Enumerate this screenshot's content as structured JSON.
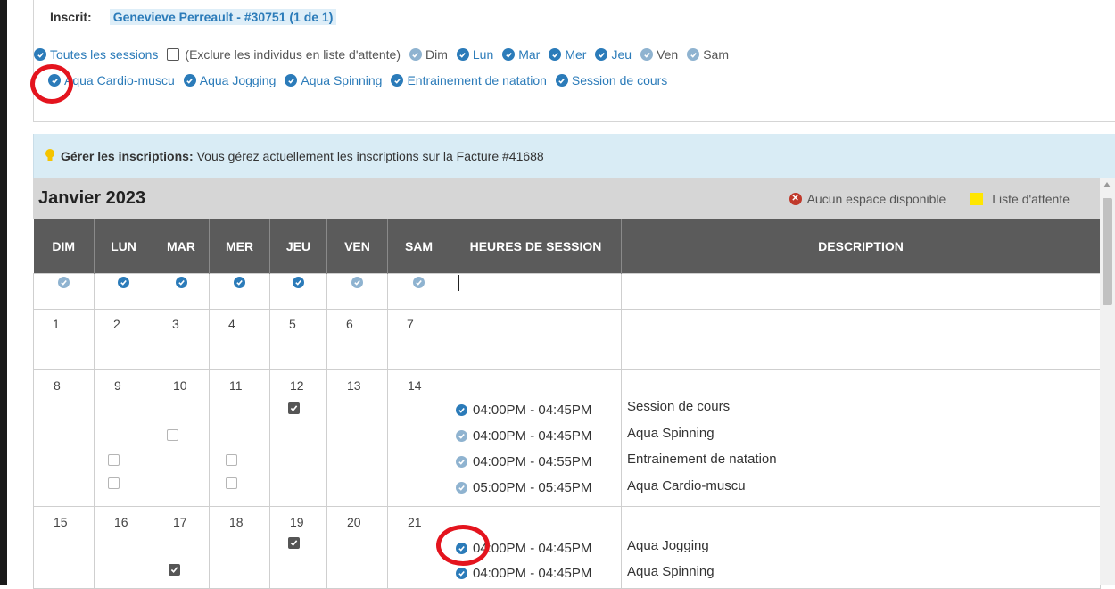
{
  "enrolled": {
    "label": "Inscrit:",
    "name": "Genevieve Perreault - #30751 (1 de 1)"
  },
  "filters": {
    "all_sessions": "Toutes les sessions",
    "exclude_waitlist": "(Exclure les individus en liste d'attente)",
    "days": [
      {
        "label": "Dim",
        "checked": false
      },
      {
        "label": "Lun",
        "checked": true
      },
      {
        "label": "Mar",
        "checked": true
      },
      {
        "label": "Mer",
        "checked": true
      },
      {
        "label": "Jeu",
        "checked": true
      },
      {
        "label": "Ven",
        "checked": false
      },
      {
        "label": "Sam",
        "checked": false
      }
    ],
    "programs": [
      {
        "label": "Aqua Cardio-muscu"
      },
      {
        "label": "Aqua Jogging"
      },
      {
        "label": "Aqua Spinning"
      },
      {
        "label": "Entrainement de natation"
      },
      {
        "label": "Session de cours"
      }
    ]
  },
  "alert": {
    "title": "Gérer les inscriptions:",
    "text": "Vous gérez actuellement les inscriptions sur la Facture #41688"
  },
  "calendar": {
    "month": "Janvier 2023",
    "legend_full": "Aucun espace disponible",
    "legend_waitlist": "Liste d'attente",
    "headers": [
      "DIM",
      "LUN",
      "MAR",
      "MER",
      "JEU",
      "VEN",
      "SAM",
      "HEURES DE SESSION",
      "DESCRIPTION"
    ],
    "week1": [
      "1",
      "2",
      "3",
      "4",
      "5",
      "6",
      "7"
    ],
    "week2": [
      "8",
      "9",
      "10",
      "11",
      "12",
      "13",
      "14"
    ],
    "week3": [
      "15",
      "16",
      "17",
      "18",
      "19",
      "20",
      "21"
    ],
    "week2_sessions": [
      {
        "time": "04:00PM - 04:45PM",
        "desc": "Session de cours",
        "active": true
      },
      {
        "time": "04:00PM - 04:45PM",
        "desc": "Aqua Spinning",
        "active": false
      },
      {
        "time": "04:00PM - 04:55PM",
        "desc": "Entrainement de natation",
        "active": false
      },
      {
        "time": "05:00PM - 05:45PM",
        "desc": "Aqua Cardio-muscu",
        "active": false
      }
    ],
    "week3_sessions": [
      {
        "time": "04:00PM - 04:45PM",
        "desc": "Aqua Jogging",
        "active": true
      },
      {
        "time": "04:00PM - 04:45PM",
        "desc": "Aqua Spinning",
        "active": true
      }
    ]
  },
  "colors": {
    "accent": "#2b7bb9",
    "highlight": "#e4141e",
    "header_bg": "#5b5b5b",
    "alert_bg": "#d9ecf5"
  }
}
